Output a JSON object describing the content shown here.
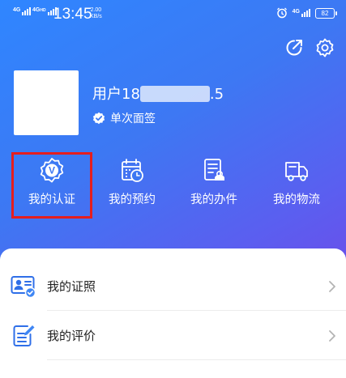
{
  "status_bar": {
    "sim1_label": "4G",
    "sim2_label": "4G",
    "sim2_hd": "HD",
    "time": "13:45",
    "net_speed_value": "2.00",
    "net_speed_unit": "KB/s",
    "signal_label": "4G",
    "battery": "82",
    "icons": [
      "alarm-icon",
      "signal-icon",
      "battery-icon"
    ]
  },
  "header": {
    "icons": [
      "share-icon",
      "settings-icon"
    ]
  },
  "profile": {
    "username_prefix": "用户18",
    "username_suffix": ".5",
    "badge_text": "单次面签",
    "badge_icon": "verified-check-icon"
  },
  "quick_actions": [
    {
      "label": "我的认证",
      "icon": "certification-badge-icon",
      "highlighted": true
    },
    {
      "label": "我的预约",
      "icon": "appointment-calendar-icon",
      "highlighted": false
    },
    {
      "label": "我的办件",
      "icon": "documents-icon",
      "highlighted": false
    },
    {
      "label": "我的物流",
      "icon": "delivery-truck-icon",
      "highlighted": false
    }
  ],
  "menu": [
    {
      "label": "我的证照",
      "icon": "license-card-icon"
    },
    {
      "label": "我的评价",
      "icon": "review-edit-icon"
    }
  ],
  "colors": {
    "gradient_start": "#2f86ff",
    "gradient_end": "#6a4fea",
    "highlight_border": "#e51e1e",
    "icon_blue": "#2f6fe8"
  }
}
